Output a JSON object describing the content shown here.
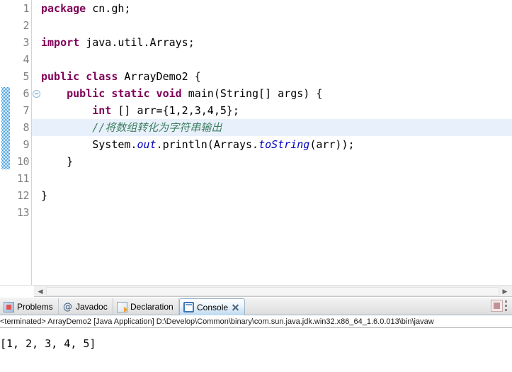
{
  "editor": {
    "line_numbers": [
      "1",
      "2",
      "3",
      "4",
      "5",
      "6",
      "7",
      "8",
      "9",
      "10",
      "11",
      "12",
      "13"
    ],
    "fold_marker_icon": "fold-collapse-icon",
    "lines": [
      {
        "n": "1",
        "segments": [
          {
            "t": "package",
            "c": "kw"
          },
          {
            "t": " cn.gh;",
            "c": "plain"
          }
        ]
      },
      {
        "n": "2",
        "segments": [
          {
            "t": "",
            "c": "plain"
          }
        ]
      },
      {
        "n": "3",
        "segments": [
          {
            "t": "import",
            "c": "kw"
          },
          {
            "t": " java.util.Arrays;",
            "c": "plain"
          }
        ]
      },
      {
        "n": "4",
        "segments": [
          {
            "t": "",
            "c": "plain"
          }
        ]
      },
      {
        "n": "5",
        "segments": [
          {
            "t": "public class",
            "c": "kw"
          },
          {
            "t": " ArrayDemo2 {",
            "c": "plain"
          }
        ]
      },
      {
        "n": "6",
        "segments": [
          {
            "t": "    ",
            "c": "plain"
          },
          {
            "t": "public static void",
            "c": "kw"
          },
          {
            "t": " main(String[] args) {",
            "c": "plain"
          }
        ]
      },
      {
        "n": "7",
        "segments": [
          {
            "t": "        ",
            "c": "plain"
          },
          {
            "t": "int",
            "c": "kw"
          },
          {
            "t": " [] arr={1,2,3,4,5};",
            "c": "plain"
          }
        ]
      },
      {
        "n": "8",
        "segments": [
          {
            "t": "        ",
            "c": "plain"
          },
          {
            "t": "//将数组转化为字符串输出",
            "c": "cmt"
          }
        ]
      },
      {
        "n": "9",
        "segments": [
          {
            "t": "        System.",
            "c": "plain"
          },
          {
            "t": "out",
            "c": "fld"
          },
          {
            "t": ".println(Arrays.",
            "c": "plain"
          },
          {
            "t": "toString",
            "c": "fld"
          },
          {
            "t": "(arr));",
            "c": "plain"
          }
        ]
      },
      {
        "n": "10",
        "segments": [
          {
            "t": "    }",
            "c": "plain"
          }
        ]
      },
      {
        "n": "11",
        "segments": [
          {
            "t": "",
            "c": "plain"
          }
        ]
      },
      {
        "n": "12",
        "segments": [
          {
            "t": "}",
            "c": "plain"
          }
        ]
      },
      {
        "n": "13",
        "segments": [
          {
            "t": "",
            "c": "plain"
          }
        ]
      }
    ],
    "highlighted_line": 8,
    "fold_range": {
      "from_line": 6,
      "to_line": 10
    },
    "colors": {
      "keyword": "#7f0055",
      "comment": "#3f7f5f",
      "field": "#0000c0",
      "line_number": "#808080",
      "current_line_highlight": "#e8f0fb",
      "fold_bar": "#3399dd"
    }
  },
  "scrollbar": {
    "left_arrow_glyph": "◀",
    "right_arrow_glyph": "▶"
  },
  "panel": {
    "tabs": [
      {
        "label": "Problems",
        "icon": "problems-icon",
        "active": false,
        "closable": false
      },
      {
        "label": "Javadoc",
        "icon": "javadoc-at-icon",
        "active": false,
        "closable": false
      },
      {
        "label": "Declaration",
        "icon": "declaration-icon",
        "active": false,
        "closable": false
      },
      {
        "label": "Console",
        "icon": "console-icon",
        "active": true,
        "closable": true
      }
    ],
    "toolbar": {
      "terminate_icon": "terminate-stop-icon",
      "menu_icon": "view-menu-icon"
    },
    "status": "<terminated> ArrayDemo2 [Java Application] D:\\Develop\\Common\\binary\\com.sun.java.jdk.win32.x86_64_1.6.0.013\\bin\\javaw",
    "output": "[1, 2, 3, 4, 5]"
  }
}
